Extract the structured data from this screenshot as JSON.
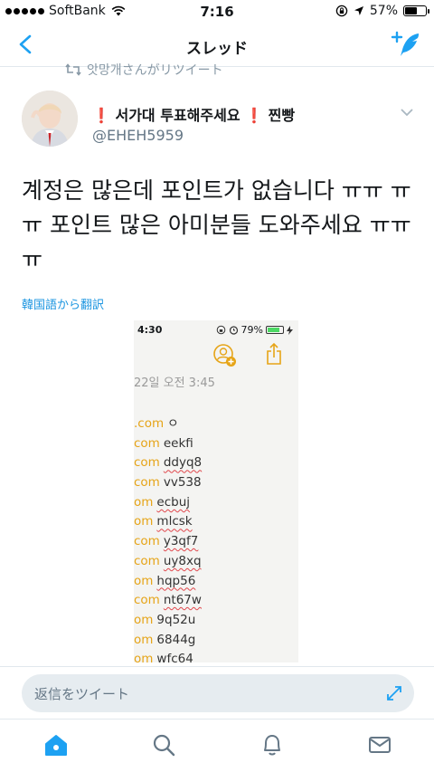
{
  "status_bar": {
    "carrier": "SoftBank",
    "time": "7:16",
    "battery": "57%",
    "battery_level": 0.57
  },
  "nav": {
    "title": "スレッド",
    "back_icon": "chevron-left-icon",
    "compose_icon": "compose-tweet-icon"
  },
  "retweet_line": "앗망개さんがリツイート",
  "tweet": {
    "display_name": "❗ 서가대 투표해주세요 ❗ 찐빵",
    "handle": "@EHEH5959",
    "text": "계정은 많은데 포인트가 없습니다 ㅠㅠ ㅠㅠ 포인트 많은 아미분들 도와주세요 ㅠㅠㅠ",
    "translate_link": "韓国語から翻訳"
  },
  "media": {
    "time": "4:30",
    "battery": "79%",
    "battery_level": 0.79,
    "date": "22일 오전 3:45",
    "lines": [
      {
        "domain": ".com",
        "password": "ㅇ",
        "squiggle": false
      },
      {
        "domain": "com",
        "password": "eekfi",
        "squiggle": false
      },
      {
        "domain": "com",
        "password": "ddyq8",
        "squiggle": true
      },
      {
        "domain": "com",
        "password": "vv538",
        "squiggle": false
      },
      {
        "domain": "om",
        "password": "ecbuj",
        "squiggle": true
      },
      {
        "domain": "om",
        "password": "mlcsk",
        "squiggle": true
      },
      {
        "domain": "com",
        "password": "y3qf7",
        "squiggle": true
      },
      {
        "domain": "com",
        "password": "uy8xq",
        "squiggle": true
      },
      {
        "domain": "om",
        "password": "hqp56",
        "squiggle": true
      },
      {
        "domain": "com",
        "password": "nt67w",
        "squiggle": true
      },
      {
        "domain": "om",
        "password": "9q52u",
        "squiggle": false
      },
      {
        "domain": "om",
        "password": "6844g",
        "squiggle": false
      },
      {
        "domain": "om",
        "password": "wfc64",
        "squiggle": true
      }
    ]
  },
  "reply": {
    "placeholder": "返信をツイート"
  },
  "tabs": [
    {
      "name": "home-icon",
      "active": true
    },
    {
      "name": "search-icon",
      "active": false
    },
    {
      "name": "notifications-icon",
      "active": false
    },
    {
      "name": "messages-icon",
      "active": false
    }
  ],
  "colors": {
    "accent": "#1da1f2",
    "link": "#1b95e0",
    "muted": "#657786",
    "media_domain": "#e6a417"
  }
}
